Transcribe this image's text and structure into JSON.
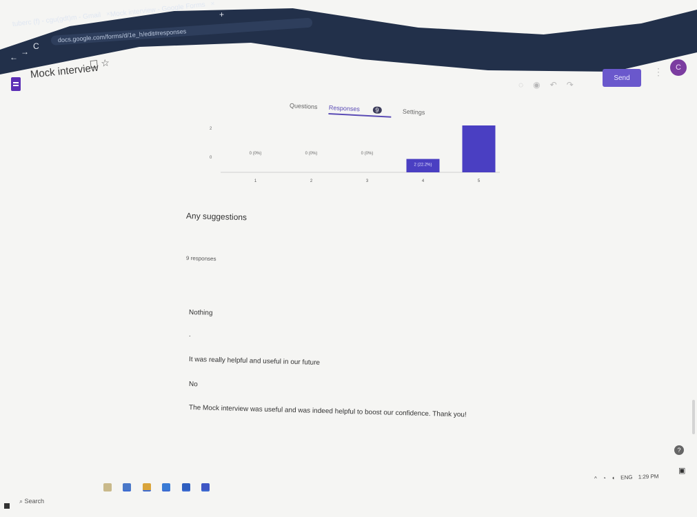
{
  "browser": {
    "tabs": [
      {
        "label": "tuberc (f) - cgu(gdt)m - Gmail",
        "close": "×"
      },
      {
        "label": "Mock interview - Google Forms",
        "close": "×"
      }
    ],
    "new_tab": "+",
    "url": "docs.google.com/forms/d/1e_h/edit#responses",
    "nav": {
      "back": "←",
      "forward": "→",
      "reload": "C"
    }
  },
  "app": {
    "title": "Mock interview",
    "icons": {
      "folder": "folder-icon",
      "star": "star-icon"
    },
    "header_icons": [
      "palette-icon",
      "eye-icon",
      "undo-icon",
      "redo-icon"
    ],
    "send_label": "Send",
    "avatar_initial": "C"
  },
  "form_tabs": {
    "questions": "Questions",
    "responses": "Responses",
    "responses_count": "9",
    "settings": "Settings"
  },
  "chart_data": {
    "type": "bar",
    "categories": [
      "1",
      "2",
      "3",
      "4",
      "5"
    ],
    "values": [
      0,
      0,
      0,
      2,
      7
    ],
    "data_labels": [
      "0 (0%)",
      "0 (0%)",
      "0 (0%)",
      "2 (22.2%)",
      ""
    ],
    "yticks": [
      "2",
      "0"
    ],
    "ylim": [
      0,
      7
    ],
    "bar_color": "#4a3fc2"
  },
  "question": {
    "title": "Any suggestions",
    "response_count": "9 responses",
    "answers": [
      "Nothing",
      ".",
      "It was really helpful and useful in our future",
      "No",
      "The Mock interview was useful and was indeed helpful to boost our confidence. Thank you!"
    ]
  },
  "help": "?",
  "taskbar": {
    "search": "Search",
    "apps": [
      "file-explorer-icon",
      "edge-icon",
      "chrome-icon",
      "chrome-icon",
      "word-icon",
      "forms-icon"
    ],
    "tray": {
      "chevron": "^",
      "lang": "ENG",
      "time": "1:29 PM"
    }
  }
}
